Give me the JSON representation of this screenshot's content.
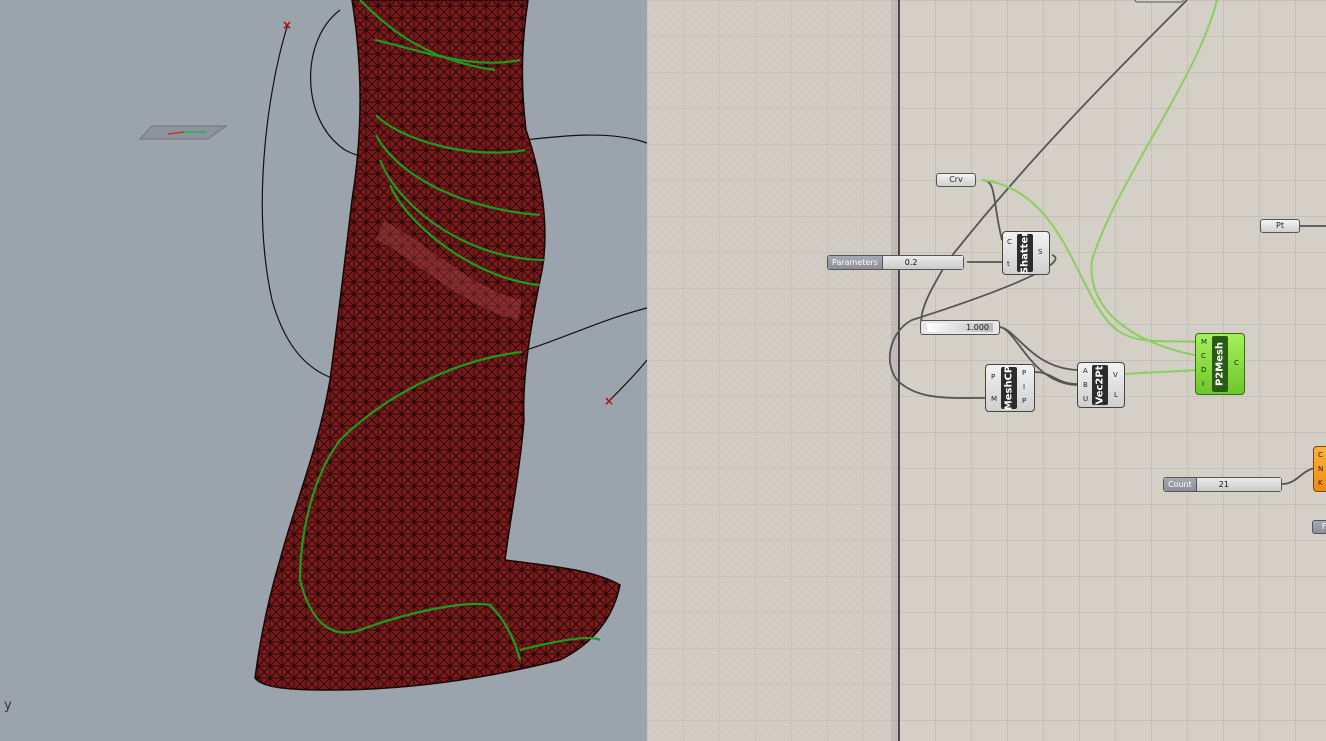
{
  "viewport": {
    "axis_label": "y"
  },
  "grasshopper": {
    "components": {
      "crv_param": "Crv",
      "pt_param": "Pt",
      "parameters_slider": {
        "name": "Parameters",
        "value": "0.2"
      },
      "unit_slider": {
        "name": "",
        "value": "1.000"
      },
      "count_slider": {
        "name": "Count",
        "value": "21"
      },
      "shatter": {
        "label": "Shatter",
        "inputs": [
          "C",
          "t"
        ],
        "outputs": [
          "S"
        ]
      },
      "meshcp": {
        "label": "MeshCP",
        "inputs": [
          "P",
          "M"
        ],
        "outputs": [
          "P",
          "I",
          "P"
        ]
      },
      "vec2pt": {
        "label": "Vec2Pt",
        "inputs": [
          "A",
          "B",
          "U"
        ],
        "outputs": [
          "V",
          "L"
        ]
      },
      "p2mesh": {
        "label": "P2Mesh",
        "inputs": [
          "M",
          "C",
          "D",
          "I"
        ],
        "outputs": [
          "C"
        ]
      },
      "orange_partial": {
        "inputs": [
          "C",
          "N",
          "K"
        ]
      },
      "f_partial": "F"
    }
  },
  "colors": {
    "viewport_bg": "#9ba3ac",
    "canvas_bg": "#d4d0c8",
    "mesh_red": "#8a1a1a",
    "curve_green": "#1f8f1f",
    "wire_dark": "#555555",
    "wire_green": "#8ccf5c",
    "component_green": "#7ad13a",
    "component_orange": "#f29a20"
  }
}
